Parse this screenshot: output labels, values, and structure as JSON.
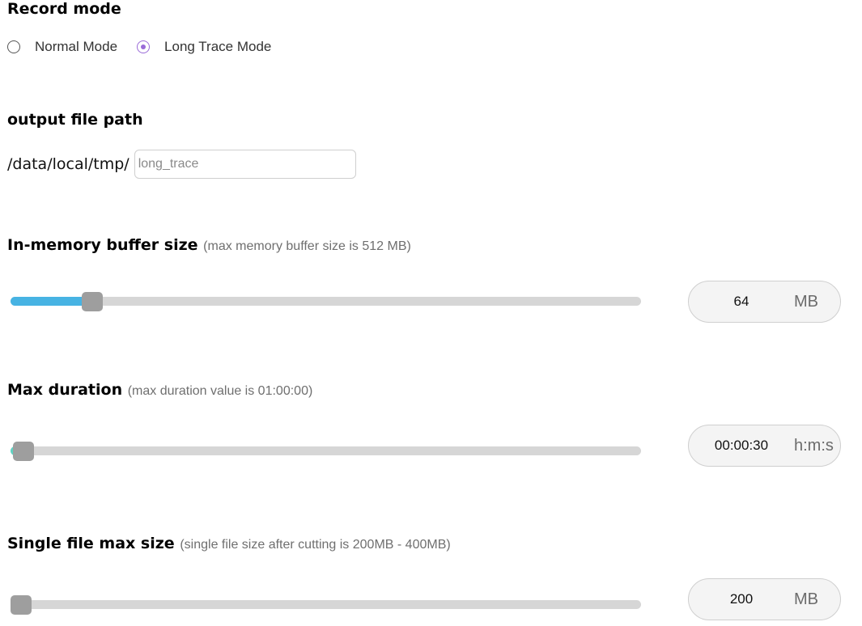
{
  "record_mode": {
    "title": "Record mode",
    "options": [
      {
        "label": "Normal Mode",
        "checked": false
      },
      {
        "label": "Long Trace Mode",
        "checked": true
      }
    ],
    "accent_color": "#9a6bd8"
  },
  "output_path": {
    "title": "output file path",
    "prefix": "/data/local/tmp/",
    "placeholder": "long_trace",
    "value": ""
  },
  "buffer_size": {
    "title": "In-memory buffer size",
    "hint": "(max memory buffer size is 512 MB)",
    "value": "64",
    "unit": "MB",
    "fill_fraction": 0.13,
    "fill_color": "#47b3e3"
  },
  "max_duration": {
    "title": "Max duration",
    "hint": "(max duration value is 01:00:00)",
    "value": "00:00:30",
    "unit": "h:m:s",
    "fill_fraction": 0.02,
    "fill_color": "#5fd3c2"
  },
  "single_file_size": {
    "title": "Single file max size",
    "hint": "(single file size after cutting is 200MB - 400MB)",
    "value": "200",
    "unit": "MB",
    "fill_fraction": 0.015,
    "fill_color": "#5fd3c2"
  }
}
